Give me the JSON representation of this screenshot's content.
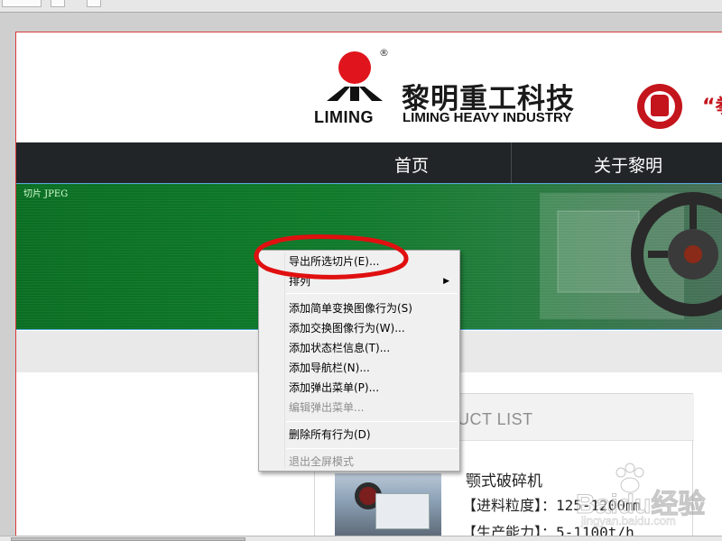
{
  "canvas_page": {
    "header": {
      "brand_en_logo": "LIMING",
      "brand_cn": "黎明重工科技",
      "brand_en": "LIMING HEAVY INDUSTRY",
      "registered": "®",
      "quote_fragment": "“拳"
    },
    "nav": {
      "items": [
        {
          "label": "首页"
        },
        {
          "label": "关于黎明"
        }
      ]
    },
    "banner": {
      "slice_label": "切片  JPEG"
    },
    "product": {
      "title": "ODUCT LIST",
      "name": "颚式破碎机",
      "specs": [
        "【进料粒度】：125-1200㎜",
        "【生产能力】：5-1100t/h"
      ]
    }
  },
  "context_menu": {
    "items": [
      {
        "label": "导出所选切片(E)...",
        "enabled": true
      },
      {
        "label": "排列",
        "enabled": true,
        "submenu": true
      },
      {
        "separator": true
      },
      {
        "label": "添加简单变换图像行为(S)",
        "enabled": true
      },
      {
        "label": "添加交换图像行为(W)...",
        "enabled": true
      },
      {
        "label": "添加状态栏信息(T)...",
        "enabled": true
      },
      {
        "label": "添加导航栏(N)...",
        "enabled": true
      },
      {
        "label": "添加弹出菜单(P)...",
        "enabled": true
      },
      {
        "label": "编辑弹出菜单...",
        "enabled": false
      },
      {
        "separator": true
      },
      {
        "label": "删除所有行为(D)",
        "enabled": true
      },
      {
        "separator": true
      },
      {
        "label": "退出全屏模式",
        "enabled": false
      }
    ],
    "submenu_arrow": "▶"
  },
  "watermark": {
    "text": "Baidu经验",
    "url": "jingyan.baidu.com"
  },
  "colors": {
    "nav_bg": "#222528",
    "banner_green": "#0e7a2a",
    "brand_red": "#c4141c",
    "annotation_red": "#e01010"
  }
}
